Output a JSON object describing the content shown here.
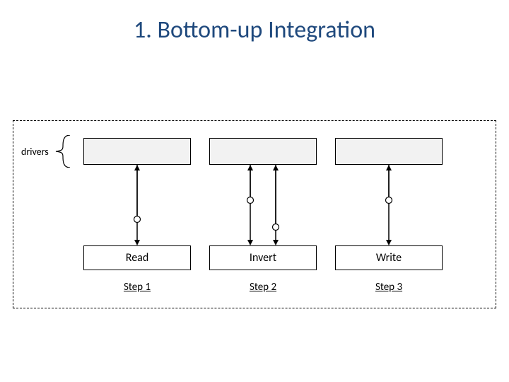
{
  "title": "1. Bottom-up Integration",
  "drivers_label": "drivers",
  "columns": [
    {
      "module": "Read",
      "step": "Step 1"
    },
    {
      "module": "Invert",
      "step": "Step 2"
    },
    {
      "module": "Write",
      "step": "Step 3"
    }
  ]
}
